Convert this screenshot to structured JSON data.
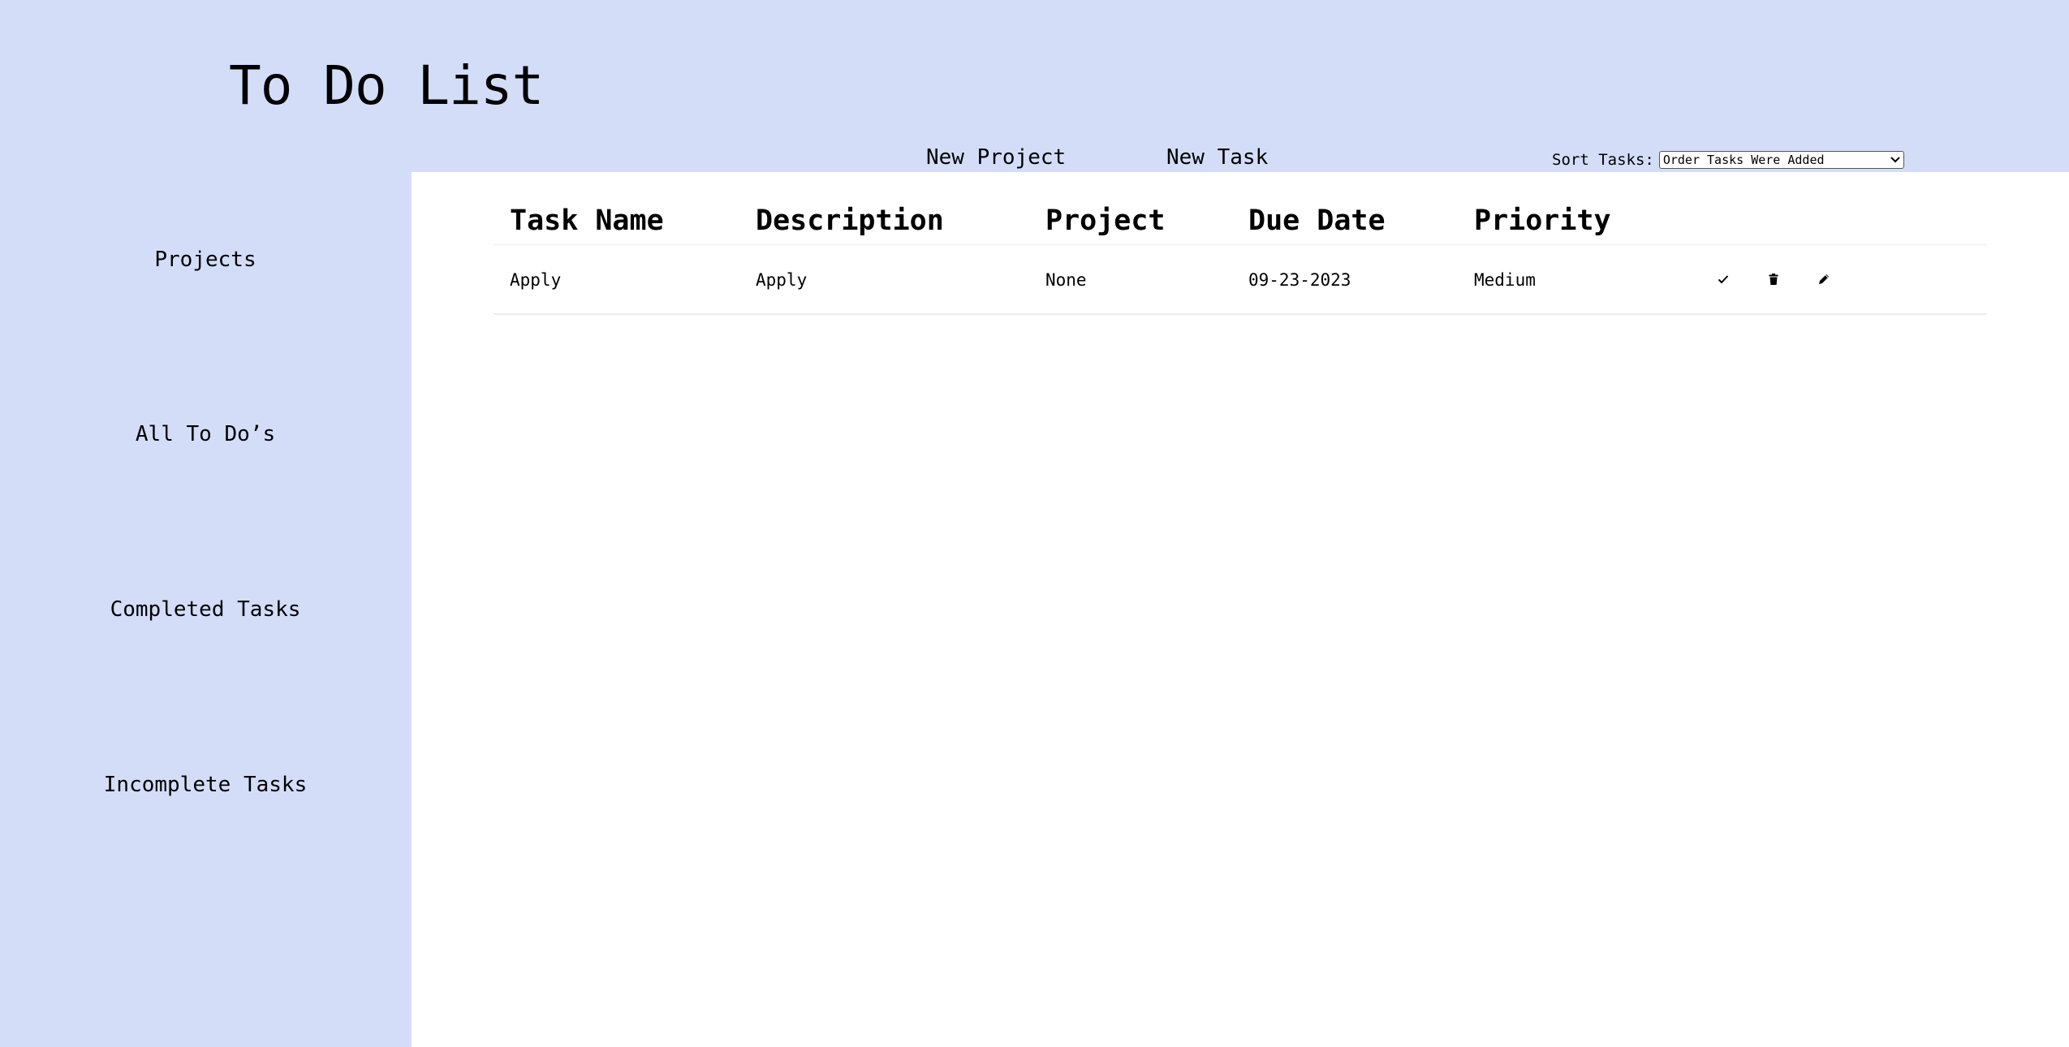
{
  "app": {
    "title": "To Do List"
  },
  "toolbar": {
    "new_project_label": "New Project",
    "new_task_label": "New Task",
    "sort_label": "Sort Tasks:",
    "sort_selected": "Order Tasks Were Added"
  },
  "sidebar": {
    "items": [
      {
        "label": "Projects"
      },
      {
        "label": "All To Do’s"
      },
      {
        "label": "Completed Tasks"
      },
      {
        "label": "Incomplete Tasks"
      }
    ]
  },
  "table": {
    "headers": [
      "Task Name",
      "Description",
      "Project",
      "Due Date",
      "Priority"
    ],
    "rows": [
      {
        "task_name": "Apply",
        "description": "Apply",
        "project": "None",
        "due_date": "09-23-2023",
        "priority": "Medium",
        "actions": [
          "check-icon",
          "trash-icon",
          "pencil-icon"
        ]
      }
    ]
  },
  "colors": {
    "background": "#d4ddf8",
    "panel": "#ffffff"
  }
}
